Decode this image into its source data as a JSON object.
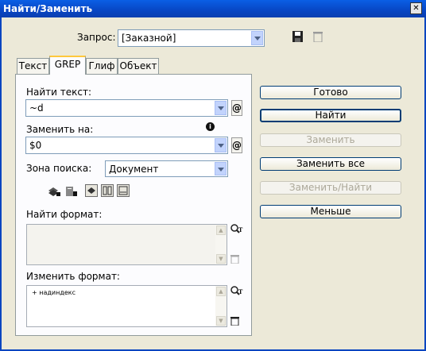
{
  "window": {
    "title": "Найти/Заменить",
    "close_glyph": "✕"
  },
  "query": {
    "label": "Запрос:",
    "value": "[Заказной]"
  },
  "tabs": [
    "Текст",
    "GREP",
    "Глиф",
    "Объект"
  ],
  "find": {
    "label": "Найти текст:",
    "value": "~d"
  },
  "replace": {
    "label": "Заменить на:",
    "value": "$0"
  },
  "scope": {
    "label": "Зона поиска:",
    "value": "Документ"
  },
  "find_format": {
    "label": "Найти формат:",
    "content": ""
  },
  "change_format": {
    "label": "Изменить формат:",
    "content": "+ надиндекс"
  },
  "buttons": {
    "done": "Готово",
    "find": "Найти",
    "replace": "Заменить",
    "replace_all": "Заменить все",
    "replace_find": "Заменить/Найти",
    "less": "Меньше"
  },
  "colors": {
    "title_bar": "#0846c4",
    "tab_highlight": "#ffc83c",
    "dialog_bg": "#ece9d8"
  }
}
